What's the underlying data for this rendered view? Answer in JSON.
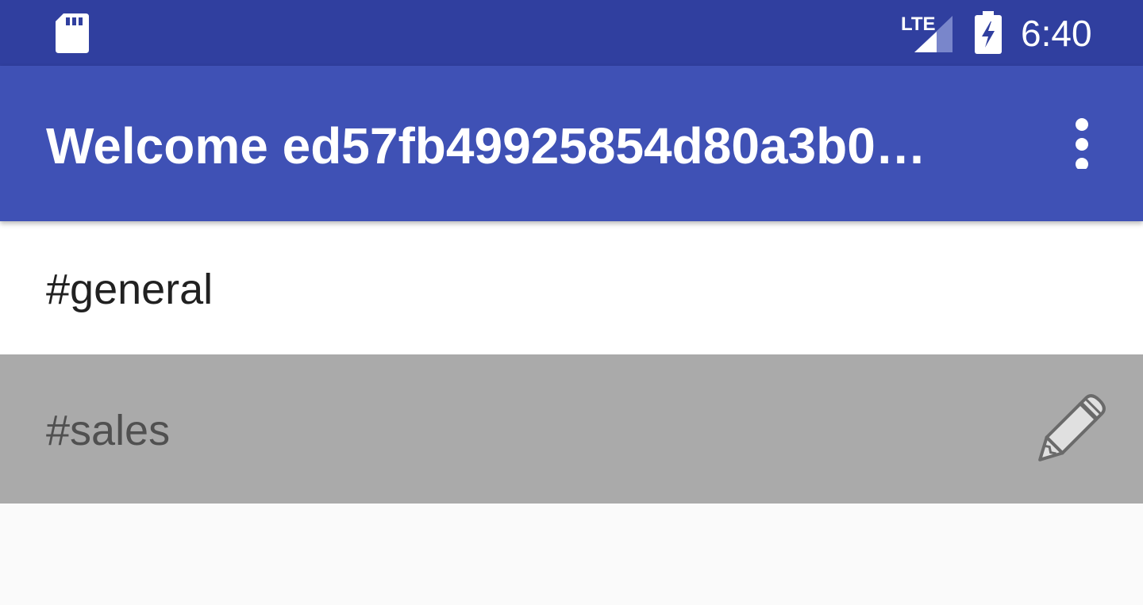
{
  "status_bar": {
    "network_label": "LTE",
    "time": "6:40",
    "icons": [
      "sd-card-icon",
      "lte-signal-icon",
      "battery-charging-icon"
    ],
    "background_color": "#303f9f"
  },
  "app_bar": {
    "title": "Welcome ed57fb49925854d80a3b0…",
    "menu_icon": "more-vert-icon",
    "background_color": "#3f51b5"
  },
  "channels": [
    {
      "label": "#general",
      "selected": false
    },
    {
      "label": "#sales",
      "selected": true,
      "action_icon": "pencil-icon"
    }
  ],
  "colors": {
    "selected_row": "#aaaaaa",
    "list_background": "#fafafa"
  }
}
